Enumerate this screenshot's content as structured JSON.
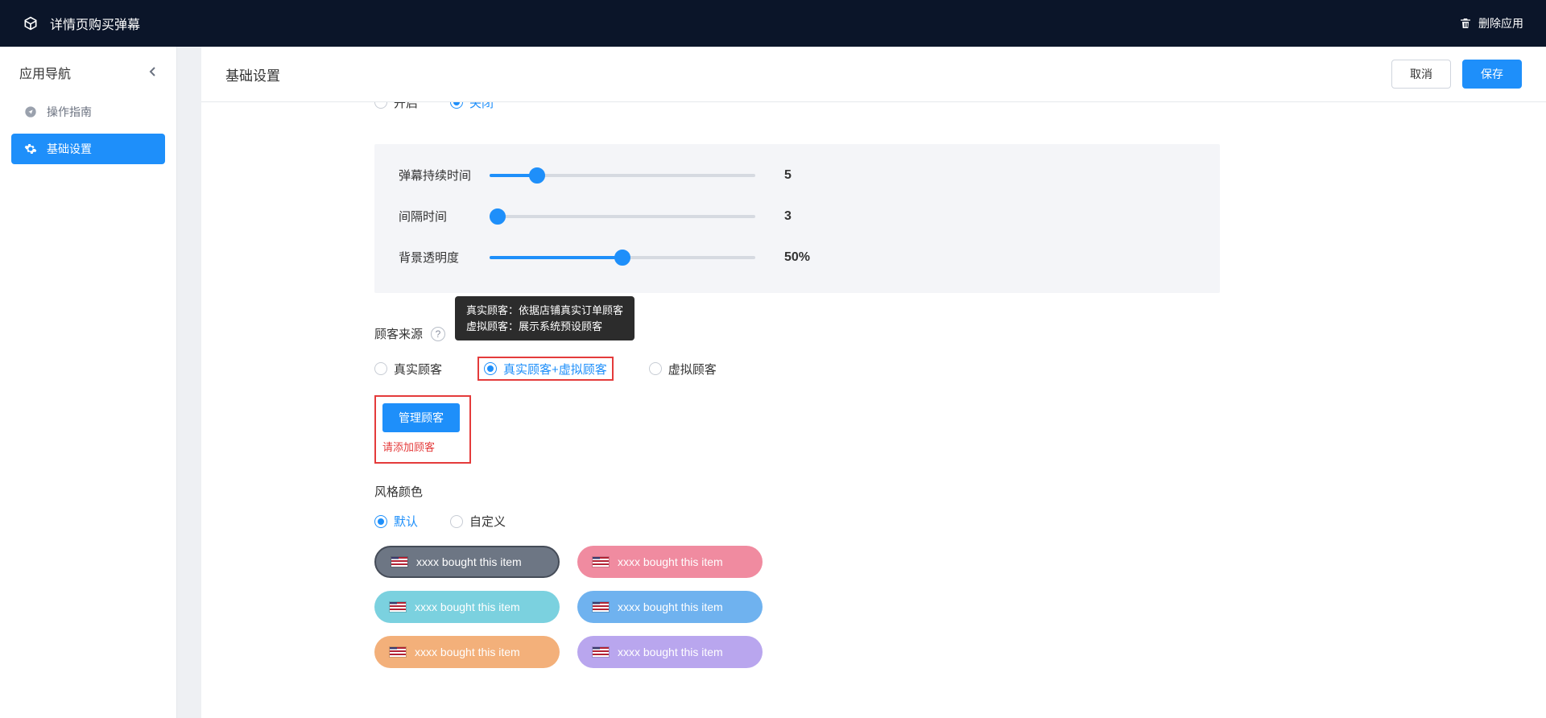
{
  "topbar": {
    "app_title": "详情页购买弹幕",
    "delete_label": "删除应用"
  },
  "sidebar": {
    "header": "应用导航",
    "items": [
      {
        "icon": "send",
        "label": "操作指南",
        "active": false
      },
      {
        "icon": "gear",
        "label": "基础设置",
        "active": true
      }
    ]
  },
  "page": {
    "title": "基础设置",
    "cancel_label": "取消",
    "save_label": "保存"
  },
  "cutoff_radio": {
    "open_label": "开启",
    "close_label": "关闭"
  },
  "sliders": {
    "duration": {
      "label": "弹幕持续时间",
      "value": "5",
      "percent": 18
    },
    "interval": {
      "label": "间隔时间",
      "value": "3",
      "percent": 3
    },
    "opacity": {
      "label": "背景透明度",
      "value": "50%",
      "percent": 50
    }
  },
  "customer_source": {
    "label": "顾客来源",
    "tooltip_line1": "真实顾客：依据店铺真实订单顾客",
    "tooltip_line2": "虚拟顾客：展示系统预设顾客",
    "opt_real": "真实顾客",
    "opt_mixed": "真实顾客+虚拟顾客",
    "opt_virtual": "虚拟顾客",
    "manage_btn": "管理顾客",
    "manage_error": "请添加顾客"
  },
  "style": {
    "label": "风格颜色",
    "opt_default": "默认",
    "opt_custom": "自定义",
    "chip_text": "xxxx bought this item",
    "chips": [
      {
        "bg": "#6d7684",
        "border": "#454c58"
      },
      {
        "bg": "#f08ba0",
        "border": "transparent"
      },
      {
        "bg": "#7bd1df",
        "border": "transparent"
      },
      {
        "bg": "#6fb2ef",
        "border": "transparent"
      },
      {
        "bg": "#f3b07a",
        "border": "transparent"
      },
      {
        "bg": "#b9a6ee",
        "border": "transparent"
      }
    ]
  }
}
